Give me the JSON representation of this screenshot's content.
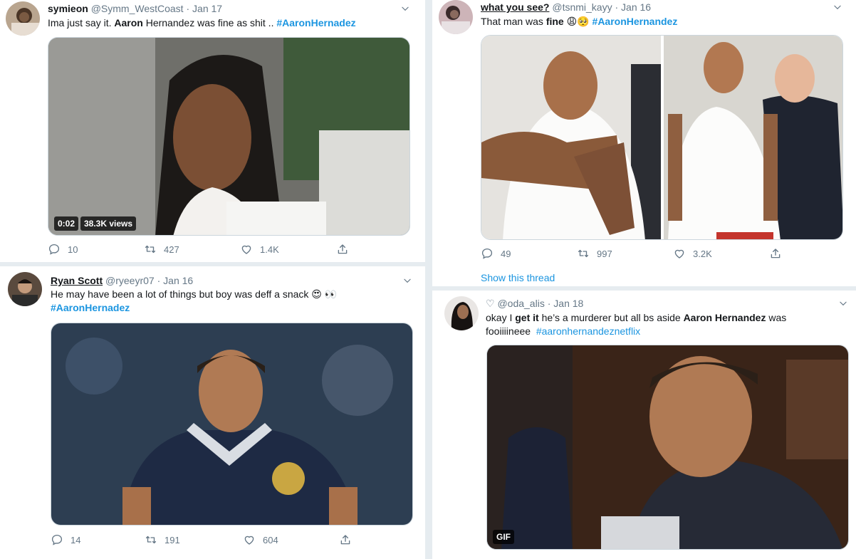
{
  "tweets": [
    {
      "name": "symieon",
      "handle": "@Symm_WestCoast",
      "sep": "·",
      "date": "Jan 17",
      "text": {
        "a": "Ima just say it. ",
        "b": "Aaron",
        "c": " Hernandez was fine as shit .. ",
        "tag": "#AaronHernadez"
      },
      "video": {
        "time": "0:02",
        "views": "38.3K views"
      },
      "counts": {
        "replies": "10",
        "retweets": "427",
        "likes": "1.4K"
      }
    },
    {
      "name": "what you see?",
      "handle": "@tsnmi_kayy",
      "sep": "·",
      "date": "Jan 16",
      "text": {
        "a": "That man was ",
        "b": "fine",
        "emoji": "😩🥺",
        "tag": "#AaronHernandez"
      },
      "counts": {
        "replies": "49",
        "retweets": "997",
        "likes": "3.2K"
      },
      "show_thread": "Show this thread"
    },
    {
      "name": "Ryan Scott",
      "handle": "@ryeeyr07",
      "sep": "·",
      "date": "Jan 16",
      "text": {
        "a": "He may have been a lot of things but boy was deff a snack ",
        "emoji": "😍 👀",
        "tag": "#AaronHernadez"
      },
      "counts": {
        "replies": "14",
        "retweets": "191",
        "likes": "604"
      }
    },
    {
      "name": "",
      "heart": "♡",
      "handle": "@oda_alis",
      "sep": "·",
      "date": "Jan 18",
      "text": {
        "a": "okay I ",
        "b": "get it",
        "c": " he’s a murderer but all bs aside ",
        "d": "Aaron Hernandez",
        "e": " was",
        "f": "fooiiiineee  ",
        "tag": "#aaronhernandeznetflix"
      },
      "gif": "GIF"
    }
  ],
  "colors": {
    "accent": "#1b95e0",
    "muted": "#657786",
    "border": "#e6ecf0"
  },
  "icons": [
    "reply-icon",
    "retweet-icon",
    "like-icon",
    "share-icon",
    "caret-down-icon"
  ]
}
